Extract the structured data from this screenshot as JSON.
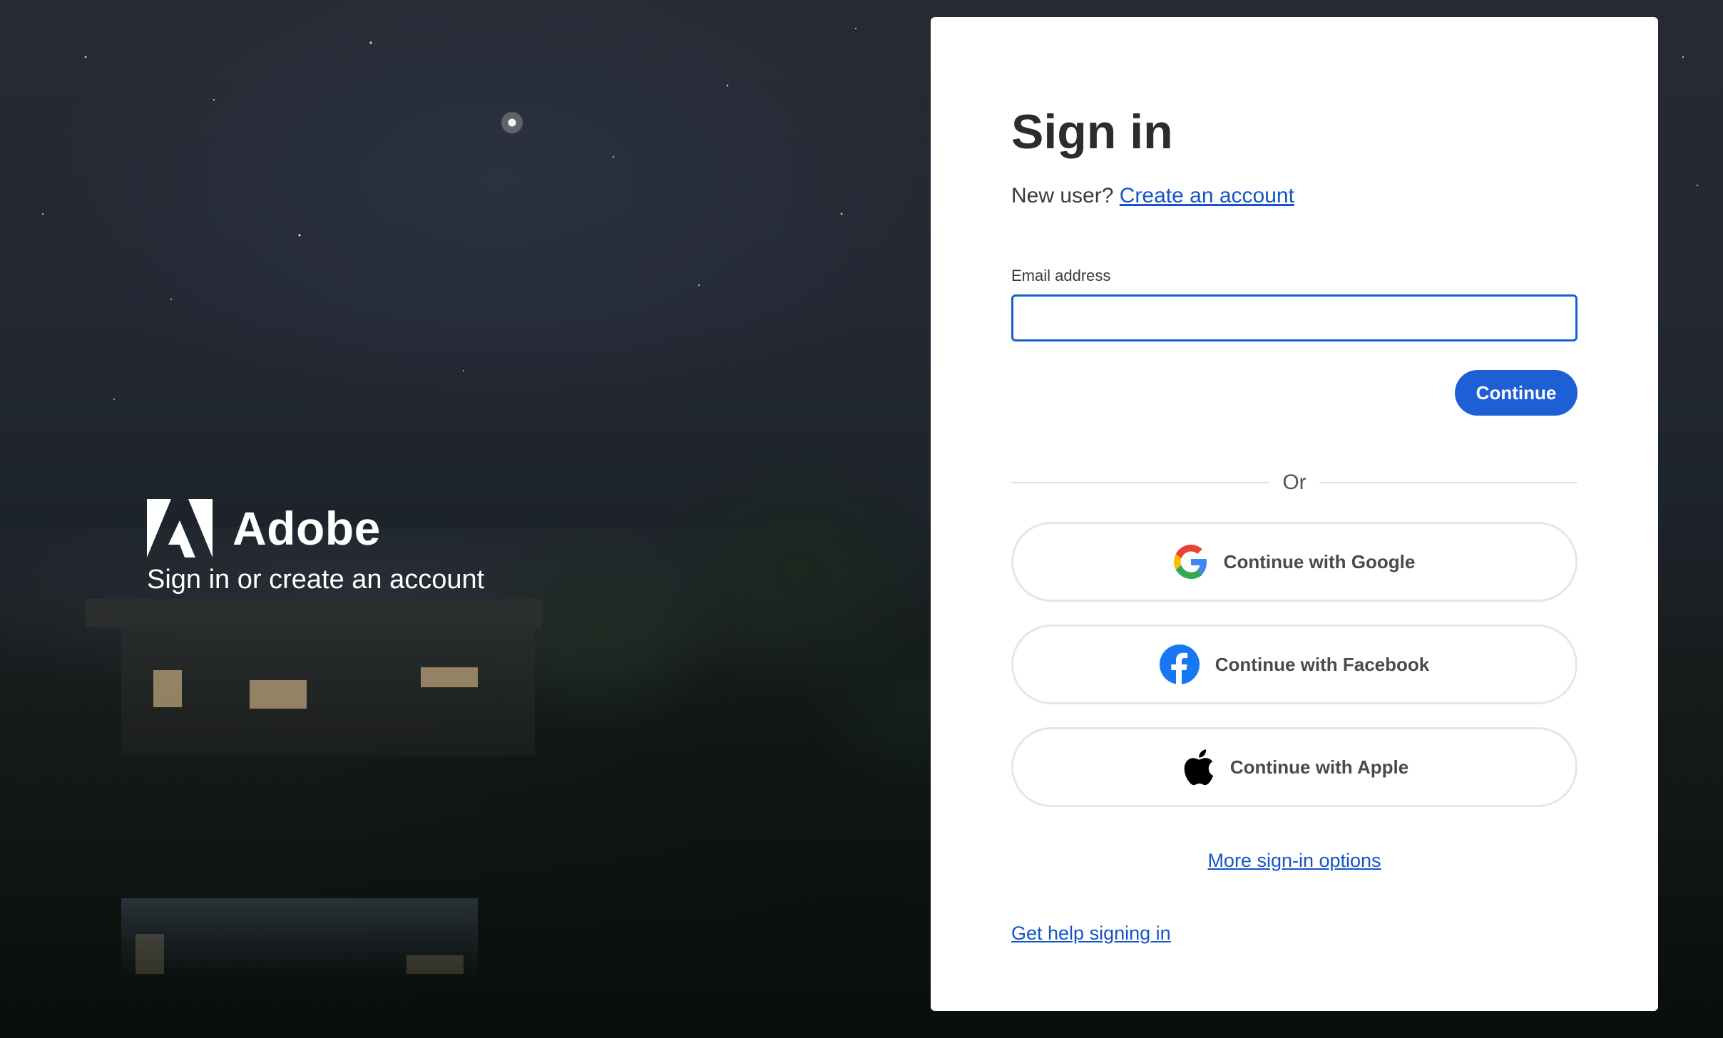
{
  "brand": {
    "name": "Adobe",
    "tagline": "Sign in or create an account"
  },
  "signin": {
    "title": "Sign in",
    "new_user_prompt": "New user?",
    "create_account_link": "Create an account",
    "email_label": "Email address",
    "email_value": "",
    "continue_label": "Continue",
    "or_label": "Or",
    "google_label": "Continue with Google",
    "facebook_label": "Continue with Facebook",
    "apple_label": "Continue with Apple",
    "more_options_link": "More sign-in options",
    "help_link": "Get help signing in"
  },
  "icons": {
    "adobe": "adobe-logo",
    "google": "google-icon",
    "facebook": "facebook-icon",
    "apple": "apple-icon"
  },
  "colors": {
    "primary": "#1e5fd6",
    "link": "#1454c7",
    "input_focus": "#1460d6",
    "facebook": "#1877f2"
  }
}
